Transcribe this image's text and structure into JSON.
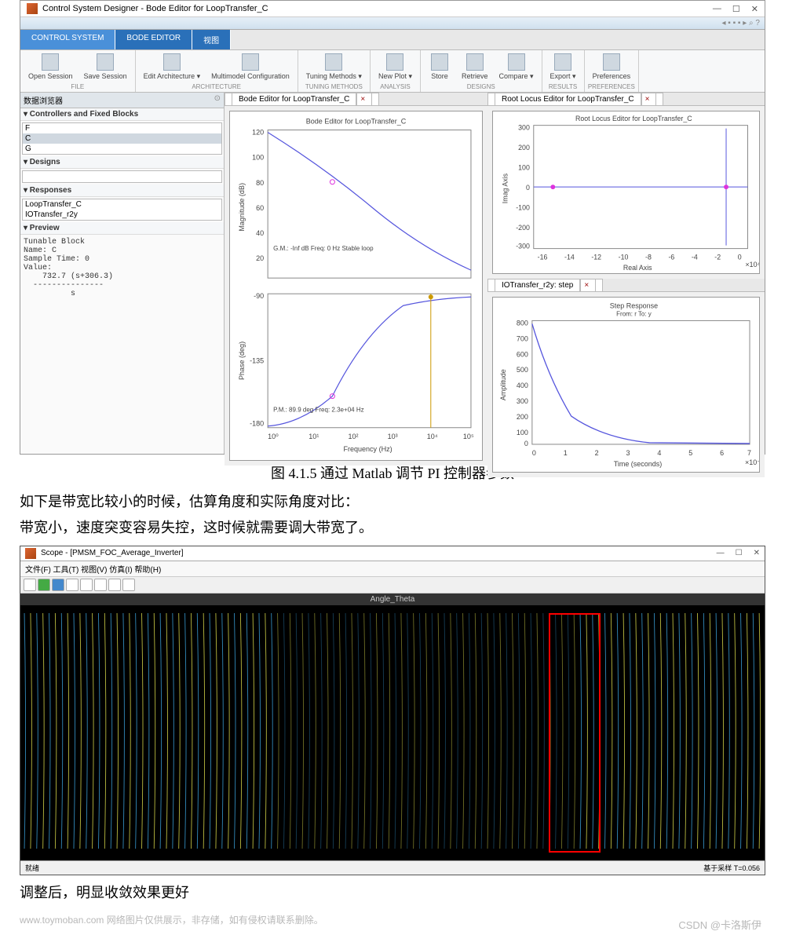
{
  "csd": {
    "title": "Control System Designer - Bode Editor for LoopTransfer_C",
    "tabs": [
      "CONTROL SYSTEM",
      "BODE EDITOR",
      "视图"
    ],
    "groups": {
      "file": {
        "label": "FILE",
        "btns": [
          {
            "l": "Open Session"
          },
          {
            "l": "Save Session"
          }
        ]
      },
      "arch": {
        "label": "ARCHITECTURE",
        "btns": [
          {
            "l": "Edit Architecture ▾"
          },
          {
            "l": "Multimodel Configuration"
          }
        ]
      },
      "tune": {
        "label": "TUNING METHODS",
        "btns": [
          {
            "l": "Tuning Methods ▾"
          }
        ]
      },
      "anal": {
        "label": "ANALYSIS",
        "btns": [
          {
            "l": "New Plot ▾"
          }
        ]
      },
      "des": {
        "label": "DESIGNS",
        "btns": [
          {
            "l": "Store"
          },
          {
            "l": "Retrieve"
          },
          {
            "l": "Compare ▾"
          }
        ]
      },
      "res": {
        "label": "RESULTS",
        "btns": [
          {
            "l": "Export ▾"
          }
        ]
      },
      "pref": {
        "label": "PREFERENCES",
        "btns": [
          {
            "l": "Preferences"
          }
        ]
      }
    },
    "browser": {
      "title": "数据浏览器",
      "sect_ctrl": "▾ Controllers and Fixed Blocks",
      "ctrl_items": [
        "F",
        "C",
        "G"
      ],
      "sect_des": "▾ Designs",
      "sect_resp": "▾ Responses",
      "resp_items": [
        "LoopTransfer_C",
        "IOTransfer_r2y"
      ],
      "sect_prev": "▾ Preview",
      "preview": "Tunable Block\nName: C\nSample Time: 0\nValue:\n    732.7 (s+306.3)\n  ---------------\n          s"
    },
    "bode": {
      "tab": "Bode Editor for LoopTransfer_C",
      "title": "Bode Editor for LoopTransfer_C",
      "mag_ylabel": "Magnitude (dB)",
      "phase_ylabel": "Phase (deg)",
      "xlabel": "Frequency (Hz)",
      "gm_text": "G.M.: -Inf dB\nFreq: 0 Hz\nStable loop",
      "pm_text": "P.M.: 89.9 deg\nFreq: 2.3e+04 Hz"
    },
    "rlocus": {
      "tab": "Root Locus Editor for LoopTransfer_C",
      "title": "Root Locus Editor for LoopTransfer_C",
      "xlabel": "Real Axis",
      "ylabel": "Imag Axis",
      "xexp": "×10⁴"
    },
    "step": {
      "tab": "IOTransfer_r2y: step",
      "title": "Step Response",
      "subtitle": "From: r  To: y",
      "xlabel": "Time (seconds)",
      "ylabel": "Amplitude",
      "xexp": "×10⁻⁵"
    }
  },
  "chart_data": [
    {
      "type": "line",
      "name": "bode_magnitude",
      "title": "Bode Editor for LoopTransfer_C",
      "xscale": "log",
      "x": [
        1,
        10,
        100,
        1000,
        10000,
        100000
      ],
      "y": [
        120,
        100,
        80,
        60,
        40,
        20
      ],
      "ylabel": "Magnitude (dB)",
      "xlabel": "Frequency (Hz)",
      "ylim": [
        20,
        120
      ],
      "annotations": [
        "G.M.: -Inf dB",
        "Freq: 0 Hz",
        "Stable loop"
      ]
    },
    {
      "type": "line",
      "name": "bode_phase",
      "xscale": "log",
      "x": [
        1,
        10,
        100,
        1000,
        10000,
        100000
      ],
      "y": [
        -178,
        -170,
        -150,
        -110,
        -95,
        -90
      ],
      "ylabel": "Phase (deg)",
      "xlabel": "Frequency (Hz)",
      "ylim": [
        -180,
        -90
      ],
      "annotations": [
        "P.M.: 89.9 deg",
        "Freq: 2.3e+04 Hz"
      ]
    },
    {
      "type": "scatter",
      "name": "root_locus",
      "title": "Root Locus Editor for LoopTransfer_C",
      "xlabel": "Real Axis",
      "ylabel": "Imag Axis",
      "xexp": "1e4",
      "xlim": [
        -16,
        2
      ],
      "ylim": [
        -350,
        350
      ],
      "poles": [
        {
          "x": -14.5,
          "y": 0
        },
        {
          "x": 0,
          "y": 0
        }
      ],
      "locus_vertical": {
        "x": 0,
        "ymin": -300,
        "ymax": 300
      }
    },
    {
      "type": "line",
      "name": "step_response",
      "title": "Step Response",
      "subtitle": "From: r  To: y",
      "xlabel": "Time (seconds)",
      "ylabel": "Amplitude",
      "xexp": "1e-5",
      "x": [
        0,
        0.5,
        1,
        1.5,
        2,
        2.5,
        3,
        4,
        5,
        6,
        7
      ],
      "y": [
        800,
        420,
        250,
        160,
        110,
        80,
        55,
        30,
        15,
        8,
        5
      ],
      "xlim": [
        0,
        7
      ],
      "ylim": [
        0,
        800
      ]
    }
  ],
  "caption": "图 4.1.5  通过 Matlab 调节 PI 控制器参数",
  "para1": "如下是带宽比较小的时候，估算角度和实际角度对比：",
  "para2": "带宽小，速度突变容易失控，这时候就需要调大带宽了。",
  "scope": {
    "title": "Scope - [PMSM_FOC_Average_Inverter]",
    "menu": "文件(F)  工具(T)  视图(V)  仿真(I)  帮助(H)",
    "plot_title": "Angle_Theta",
    "status_left": "就绪",
    "status_right": "基于采样  T=0.056"
  },
  "para3": "调整后，明显收敛效果更好",
  "watermark": "www.toymoban.com 网络图片仅供展示，非存储，如有侵权请联系删除。",
  "csdn": "CSDN @卡洛斯伊"
}
